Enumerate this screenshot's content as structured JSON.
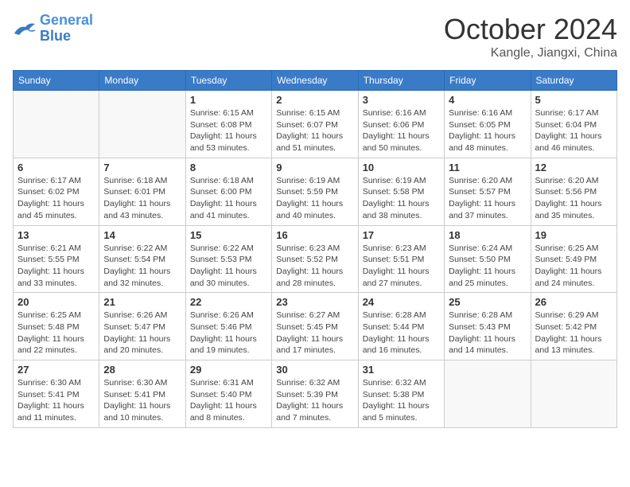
{
  "header": {
    "logo_line1": "General",
    "logo_line2": "Blue",
    "month": "October 2024",
    "location": "Kangle, Jiangxi, China"
  },
  "weekdays": [
    "Sunday",
    "Monday",
    "Tuesday",
    "Wednesday",
    "Thursday",
    "Friday",
    "Saturday"
  ],
  "weeks": [
    [
      {
        "day": "",
        "info": ""
      },
      {
        "day": "",
        "info": ""
      },
      {
        "day": "1",
        "info": "Sunrise: 6:15 AM\nSunset: 6:08 PM\nDaylight: 11 hours and 53 minutes."
      },
      {
        "day": "2",
        "info": "Sunrise: 6:15 AM\nSunset: 6:07 PM\nDaylight: 11 hours and 51 minutes."
      },
      {
        "day": "3",
        "info": "Sunrise: 6:16 AM\nSunset: 6:06 PM\nDaylight: 11 hours and 50 minutes."
      },
      {
        "day": "4",
        "info": "Sunrise: 6:16 AM\nSunset: 6:05 PM\nDaylight: 11 hours and 48 minutes."
      },
      {
        "day": "5",
        "info": "Sunrise: 6:17 AM\nSunset: 6:04 PM\nDaylight: 11 hours and 46 minutes."
      }
    ],
    [
      {
        "day": "6",
        "info": "Sunrise: 6:17 AM\nSunset: 6:02 PM\nDaylight: 11 hours and 45 minutes."
      },
      {
        "day": "7",
        "info": "Sunrise: 6:18 AM\nSunset: 6:01 PM\nDaylight: 11 hours and 43 minutes."
      },
      {
        "day": "8",
        "info": "Sunrise: 6:18 AM\nSunset: 6:00 PM\nDaylight: 11 hours and 41 minutes."
      },
      {
        "day": "9",
        "info": "Sunrise: 6:19 AM\nSunset: 5:59 PM\nDaylight: 11 hours and 40 minutes."
      },
      {
        "day": "10",
        "info": "Sunrise: 6:19 AM\nSunset: 5:58 PM\nDaylight: 11 hours and 38 minutes."
      },
      {
        "day": "11",
        "info": "Sunrise: 6:20 AM\nSunset: 5:57 PM\nDaylight: 11 hours and 37 minutes."
      },
      {
        "day": "12",
        "info": "Sunrise: 6:20 AM\nSunset: 5:56 PM\nDaylight: 11 hours and 35 minutes."
      }
    ],
    [
      {
        "day": "13",
        "info": "Sunrise: 6:21 AM\nSunset: 5:55 PM\nDaylight: 11 hours and 33 minutes."
      },
      {
        "day": "14",
        "info": "Sunrise: 6:22 AM\nSunset: 5:54 PM\nDaylight: 11 hours and 32 minutes."
      },
      {
        "day": "15",
        "info": "Sunrise: 6:22 AM\nSunset: 5:53 PM\nDaylight: 11 hours and 30 minutes."
      },
      {
        "day": "16",
        "info": "Sunrise: 6:23 AM\nSunset: 5:52 PM\nDaylight: 11 hours and 28 minutes."
      },
      {
        "day": "17",
        "info": "Sunrise: 6:23 AM\nSunset: 5:51 PM\nDaylight: 11 hours and 27 minutes."
      },
      {
        "day": "18",
        "info": "Sunrise: 6:24 AM\nSunset: 5:50 PM\nDaylight: 11 hours and 25 minutes."
      },
      {
        "day": "19",
        "info": "Sunrise: 6:25 AM\nSunset: 5:49 PM\nDaylight: 11 hours and 24 minutes."
      }
    ],
    [
      {
        "day": "20",
        "info": "Sunrise: 6:25 AM\nSunset: 5:48 PM\nDaylight: 11 hours and 22 minutes."
      },
      {
        "day": "21",
        "info": "Sunrise: 6:26 AM\nSunset: 5:47 PM\nDaylight: 11 hours and 20 minutes."
      },
      {
        "day": "22",
        "info": "Sunrise: 6:26 AM\nSunset: 5:46 PM\nDaylight: 11 hours and 19 minutes."
      },
      {
        "day": "23",
        "info": "Sunrise: 6:27 AM\nSunset: 5:45 PM\nDaylight: 11 hours and 17 minutes."
      },
      {
        "day": "24",
        "info": "Sunrise: 6:28 AM\nSunset: 5:44 PM\nDaylight: 11 hours and 16 minutes."
      },
      {
        "day": "25",
        "info": "Sunrise: 6:28 AM\nSunset: 5:43 PM\nDaylight: 11 hours and 14 minutes."
      },
      {
        "day": "26",
        "info": "Sunrise: 6:29 AM\nSunset: 5:42 PM\nDaylight: 11 hours and 13 minutes."
      }
    ],
    [
      {
        "day": "27",
        "info": "Sunrise: 6:30 AM\nSunset: 5:41 PM\nDaylight: 11 hours and 11 minutes."
      },
      {
        "day": "28",
        "info": "Sunrise: 6:30 AM\nSunset: 5:41 PM\nDaylight: 11 hours and 10 minutes."
      },
      {
        "day": "29",
        "info": "Sunrise: 6:31 AM\nSunset: 5:40 PM\nDaylight: 11 hours and 8 minutes."
      },
      {
        "day": "30",
        "info": "Sunrise: 6:32 AM\nSunset: 5:39 PM\nDaylight: 11 hours and 7 minutes."
      },
      {
        "day": "31",
        "info": "Sunrise: 6:32 AM\nSunset: 5:38 PM\nDaylight: 11 hours and 5 minutes."
      },
      {
        "day": "",
        "info": ""
      },
      {
        "day": "",
        "info": ""
      }
    ]
  ]
}
